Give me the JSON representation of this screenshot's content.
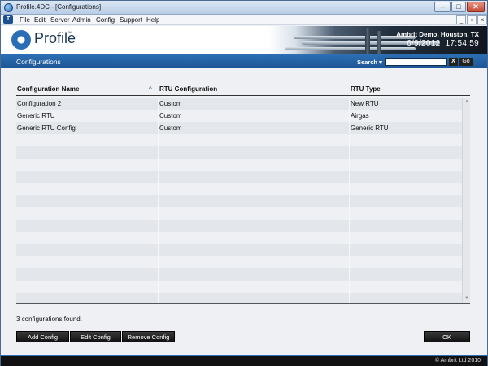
{
  "window": {
    "title": "Profile.4DC - [Configurations]",
    "controls": {
      "minimize": "–",
      "maximize": "□",
      "close": "✕"
    }
  },
  "menu": {
    "items": [
      "File",
      "Edit",
      "Server",
      "Admin",
      "Config",
      "Support",
      "Help"
    ],
    "mdi_controls": {
      "minimize": "_",
      "restore": "▫",
      "close": "×"
    }
  },
  "header": {
    "logo_text": "Profile",
    "logo_tm": "™",
    "site_name": "Ambrit Demo, Houston, TX",
    "date": "6/9/2012",
    "time": "17:54:59"
  },
  "toolbar": {
    "page_title": "Configurations",
    "search_label": "Search ▾",
    "search_value": "",
    "clear_label": "X",
    "go_label": "Go"
  },
  "table": {
    "columns": [
      "Configuration Name",
      "RTU Configuration",
      "RTU Type"
    ],
    "sort_indicator": "^",
    "rows": [
      [
        "Configuration 2",
        "Custom",
        "New RTU"
      ],
      [
        "Generic RTU",
        "Custom",
        "Airgas"
      ],
      [
        "Generic RTU Config",
        "Custom",
        "Generic RTU"
      ]
    ],
    "empty_row_count": 14
  },
  "status": {
    "count_text": "3 configurations found."
  },
  "buttons": {
    "add": "Add Config",
    "edit": "Edit Config",
    "remove": "Remove Config",
    "ok": "OK"
  },
  "footer": {
    "copyright": "© Ambrit Ltd 2010"
  },
  "colors": {
    "accent_blue": "#1d5594",
    "button_black": "#111111",
    "row_alt": "#e3e6ea"
  }
}
